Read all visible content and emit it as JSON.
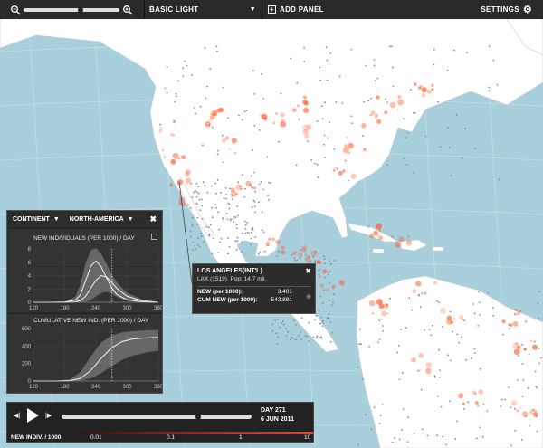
{
  "topbar": {
    "zoom_out_icon": "zoom-out-icon",
    "zoom_in_icon": "zoom-in-icon",
    "zoom_level": 0.6,
    "basemap_label": "BASIC LIGHT",
    "add_panel_label": "ADD PANEL",
    "settings_label": "SETTINGS"
  },
  "continent_panel": {
    "level_label": "CONTINENT",
    "region_label": "NORTH-AMERICA",
    "chart1_title": "NEW INDIVIDUALS (PER 1000) / DAY",
    "chart2_title": "CUMULATIVE NEW IND. (PER 1000) / DAY"
  },
  "chart_data": [
    {
      "type": "area",
      "title": "NEW INDIVIDUALS (PER 1000) / DAY",
      "xlim": [
        120,
        360
      ],
      "ylim": [
        0,
        8
      ],
      "x_ticks": [
        "120",
        "180",
        "240",
        "300",
        "360"
      ],
      "y_ticks": [
        "0",
        "2",
        "4",
        "6",
        "8"
      ],
      "x": [
        120,
        150,
        180,
        200,
        210,
        220,
        230,
        240,
        250,
        260,
        270,
        280,
        300,
        330,
        360
      ],
      "series": [
        {
          "values": [
            0,
            0,
            0.05,
            0.3,
            1.1,
            3.2,
            5.4,
            6.2,
            5.3,
            3.7,
            2.2,
            1.2,
            0.35,
            0.05,
            0
          ]
        },
        {
          "values": [
            0,
            0,
            0,
            0.05,
            0.25,
            0.9,
            2.1,
            3.3,
            4.0,
            3.8,
            3.0,
            2.1,
            0.9,
            0.2,
            0
          ]
        }
      ],
      "band_upper": [
        0,
        0,
        0.1,
        0.8,
        2.6,
        5.8,
        7.8,
        8.1,
        7.3,
        5.8,
        4.2,
        3.0,
        1.4,
        0.4,
        0
      ],
      "band_lower": [
        0,
        0,
        0,
        0,
        0,
        0.1,
        0.3,
        0.9,
        1.4,
        1.6,
        1.3,
        0.8,
        0.2,
        0,
        0
      ],
      "marker_x": 271
    },
    {
      "type": "area",
      "title": "CUMULATIVE NEW IND. (PER 1000) / DAY",
      "xlim": [
        120,
        360
      ],
      "ylim": [
        0,
        600
      ],
      "x_ticks": [
        "120",
        "180",
        "240",
        "300",
        "360"
      ],
      "y_ticks": [
        "0",
        "200",
        "400",
        "600"
      ],
      "x": [
        120,
        160,
        190,
        210,
        230,
        250,
        270,
        290,
        310,
        340,
        360
      ],
      "series": [
        {
          "values": [
            0,
            0,
            5,
            30,
            120,
            260,
            380,
            450,
            480,
            495,
            500
          ]
        }
      ],
      "band_upper": [
        0,
        0,
        20,
        100,
        280,
        440,
        520,
        555,
        570,
        580,
        585
      ],
      "band_lower": [
        0,
        0,
        0,
        5,
        30,
        90,
        170,
        240,
        290,
        330,
        345
      ],
      "marker_x": 271
    }
  ],
  "tooltip": {
    "title": "LOS ANGELES(INT'L)",
    "subtitle": "LAX (1519). Pop: 14.7 mil.",
    "new_label": "NEW (per 1000):",
    "new_value": "3.401",
    "cum_label": "CUM NEW (per 1000):",
    "cum_value": "543.891"
  },
  "timeline": {
    "day_label": "DAY 271",
    "date_label": "6 JUN 2011",
    "progress": 0.72,
    "scale_title": "NEW INDIV. / 1000",
    "scale_ticks": [
      "0.01",
      "0.1",
      "1",
      "10"
    ]
  },
  "colors": {
    "ocean": "#a7cfdc",
    "land": "#ffffff",
    "hotspot": "#ff5a28",
    "panel": "#2c2c2c",
    "accent_red": "#e02a10"
  }
}
